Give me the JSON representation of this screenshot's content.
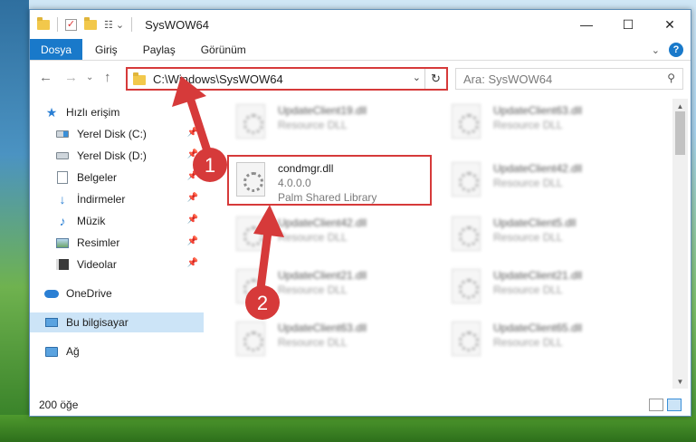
{
  "window": {
    "title": "SysWOW64",
    "controls": {
      "minimize": "—",
      "maximize": "☐",
      "close": "✕"
    }
  },
  "ribbon": {
    "tabs": [
      "Dosya",
      "Giriş",
      "Paylaş",
      "Görünüm"
    ],
    "collapse": "⌄",
    "help": "?"
  },
  "navigation": {
    "back": "←",
    "forward": "→",
    "recent": "⌄",
    "up": "↑",
    "address": "C:\\Windows\\SysWOW64",
    "address_dropdown": "⌄",
    "refresh": "↻"
  },
  "search": {
    "placeholder": "Ara: SysWOW64",
    "icon": "search-icon"
  },
  "sidebar": {
    "quick_access": "Hızlı erişim",
    "pinned": [
      {
        "label": "Yerel Disk (C:)",
        "icon": "drive-icon"
      },
      {
        "label": "Yerel Disk (D:)",
        "icon": "drive-icon"
      },
      {
        "label": "Belgeler",
        "icon": "documents-icon"
      },
      {
        "label": "İndirmeler",
        "icon": "downloads-icon"
      },
      {
        "label": "Müzik",
        "icon": "music-icon"
      },
      {
        "label": "Resimler",
        "icon": "pictures-icon"
      },
      {
        "label": "Videolar",
        "icon": "videos-icon"
      }
    ],
    "onedrive": "OneDrive",
    "this_pc": "Bu bilgisayar",
    "network": "Ağ"
  },
  "files": {
    "left_column": [
      {
        "name": "UpdateClient19.dll",
        "type": "Resource DLL"
      },
      {
        "name": "UpdateClient42.dll",
        "type": "Resource DLL"
      },
      {
        "name": "UpdateClient21.dll",
        "type": "Resource DLL"
      },
      {
        "name": "UpdateClient63.dll",
        "type": "Resource DLL"
      }
    ],
    "right_column": [
      {
        "name": "UpdateClient63.dll",
        "type": "Resource DLL"
      },
      {
        "name": "UpdateClient42.dll",
        "type": "Resource DLL"
      },
      {
        "name": "UpdateClient5.dll",
        "type": "Resource DLL"
      },
      {
        "name": "UpdateClient21.dll",
        "type": "Resource DLL"
      },
      {
        "name": "UpdateClient65.dll",
        "type": "Resource DLL"
      }
    ],
    "highlighted": {
      "name": "condmgr.dll",
      "version": "4.0.0.0",
      "description": "Palm Shared Library"
    }
  },
  "status": {
    "item_count": "200 öğe"
  },
  "annotations": {
    "step1": "1",
    "step2": "2",
    "color": "#d63a3a"
  }
}
